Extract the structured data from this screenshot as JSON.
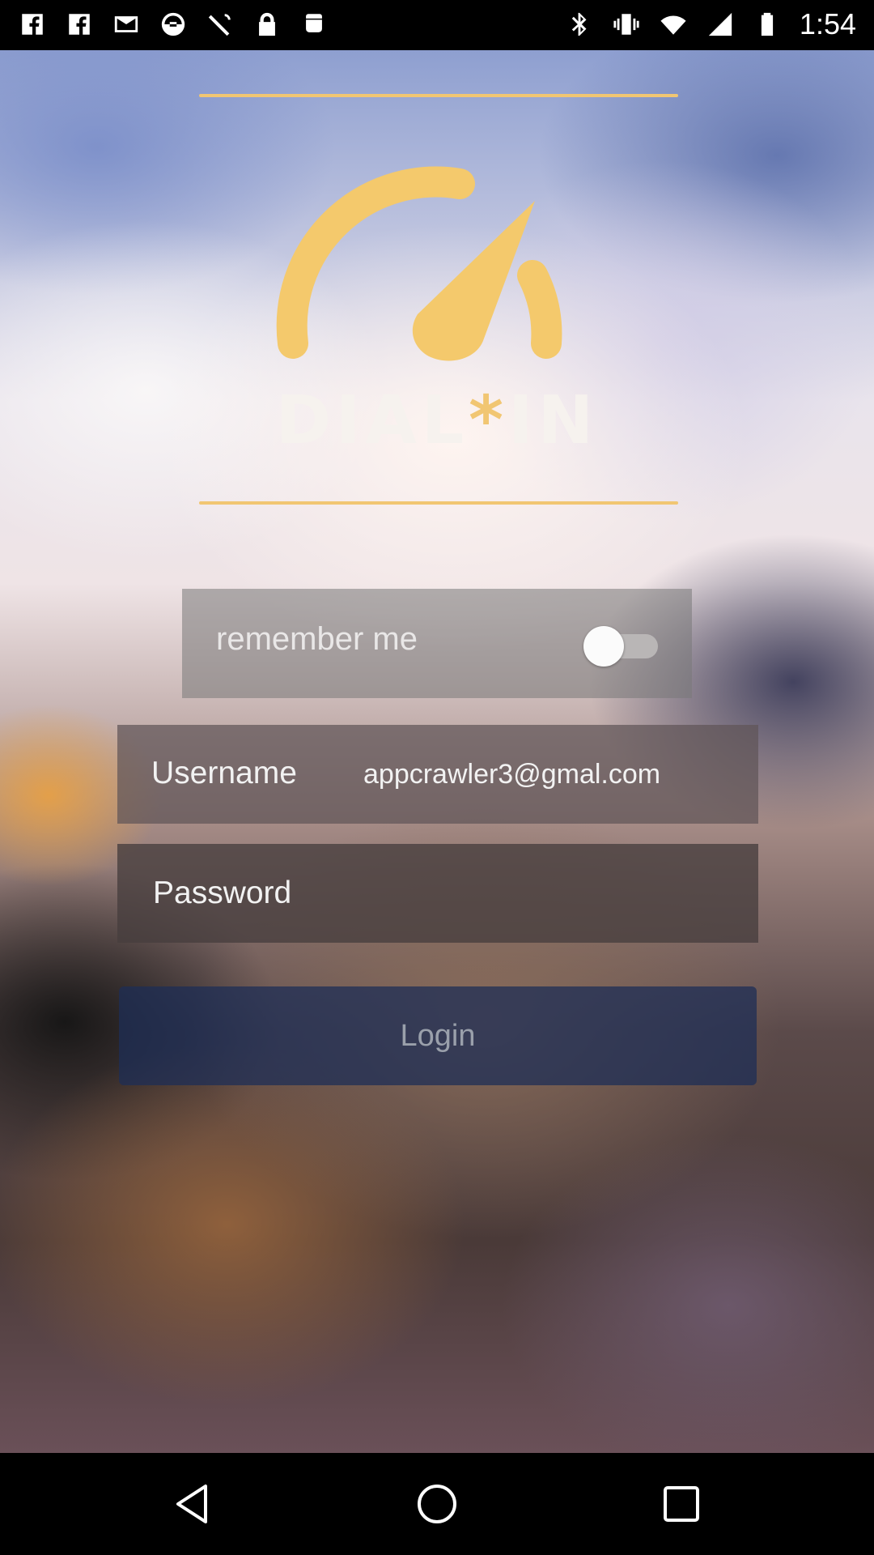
{
  "status_bar": {
    "time": "1:54",
    "left_icons": [
      "fb-icon",
      "fb-icon",
      "gmail-icon",
      "block-icon",
      "satellite-icon",
      "lock-icon",
      "android-icon"
    ],
    "right_icons": [
      "bluetooth-icon",
      "vibrate-icon",
      "wifi-icon",
      "cell-signal-icon",
      "battery-icon"
    ]
  },
  "logo": {
    "brand_left": "DIAL",
    "brand_star": "*",
    "brand_right": "IN",
    "accent_color": "#f1c672"
  },
  "remember": {
    "label": "remember me",
    "toggle_on": false
  },
  "username": {
    "label": "Username",
    "value": "appcrawler3@gmal.com"
  },
  "password": {
    "placeholder": "Password"
  },
  "login": {
    "label": "Login"
  },
  "nav": [
    "back-icon",
    "home-icon",
    "recent-apps-icon"
  ]
}
